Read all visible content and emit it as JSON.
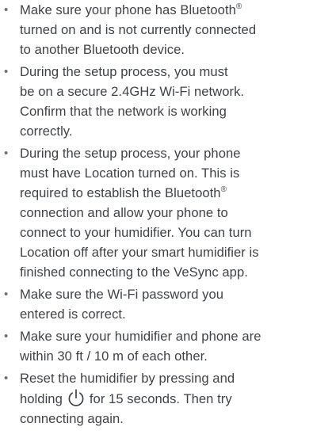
{
  "instructions": {
    "bullet_char": "•",
    "registered_mark": "®",
    "items": [
      {
        "lines": [
          [
            "Make sure your phone has Bluetooth",
            "®"
          ],
          [
            "turned on and is not currently connected"
          ],
          [
            "to another Bluetooth device."
          ]
        ]
      },
      {
        "lines": [
          [
            "During the setup process, you must"
          ],
          [
            "be on a secure 2.4GHz Wi-Fi network."
          ],
          [
            "Confirm that the network is working"
          ],
          [
            "correctly."
          ]
        ]
      },
      {
        "lines": [
          [
            "During the setup process, your phone"
          ],
          [
            "must have Location turned on. This is"
          ],
          [
            "required to establish the Bluetooth",
            "®"
          ],
          [
            "connection and allow your phone to"
          ],
          [
            "connect to your humidifier. You can turn"
          ],
          [
            "Location off after your smart humidifier is"
          ],
          [
            "finished connecting to the VeSync app."
          ]
        ]
      },
      {
        "lines": [
          [
            "Make sure the Wi-Fi password you"
          ],
          [
            "entered is correct."
          ]
        ]
      },
      {
        "lines": [
          [
            "Make sure your humidifier and phone are"
          ],
          [
            "within 30 ft / 10 m of each other."
          ]
        ]
      },
      {
        "lines": [
          [
            "Reset the humidifier by pressing and"
          ],
          [
            "holding",
            "power-icon",
            "for 15 seconds. Then try"
          ],
          [
            "connecting again."
          ]
        ]
      }
    ]
  },
  "icons": {
    "power": "power-icon"
  },
  "colors": {
    "text": "#3f4246",
    "bullet": "#6d7075"
  }
}
